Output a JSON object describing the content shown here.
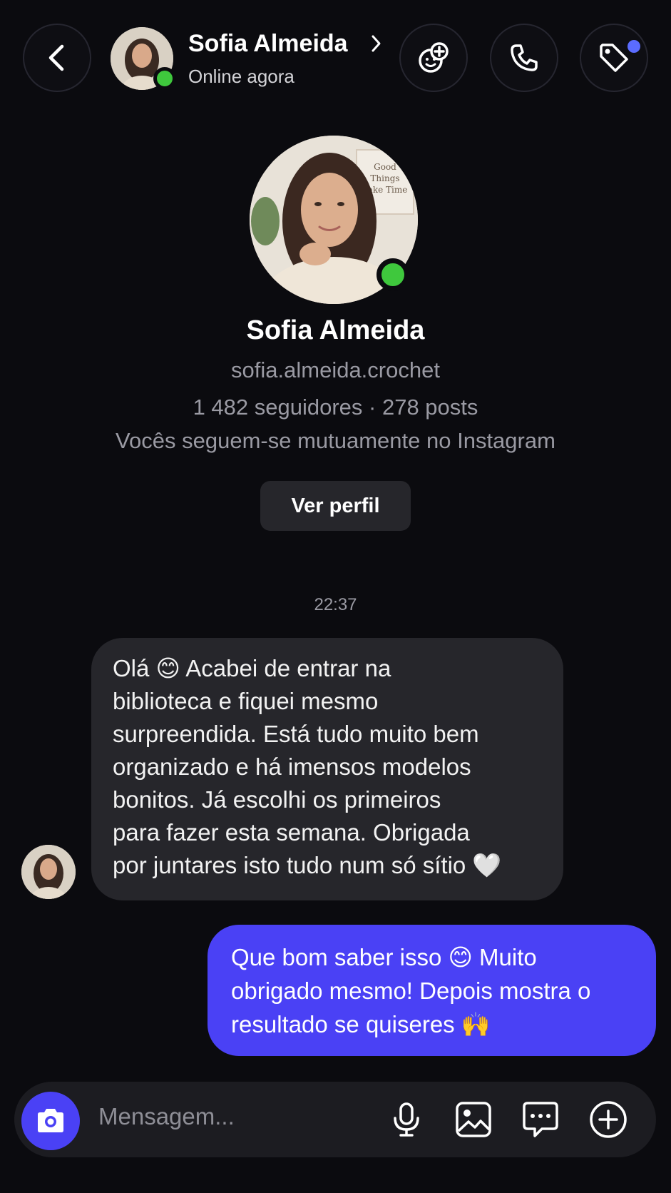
{
  "header": {
    "name": "Sofia Almeida",
    "status": "Online agora",
    "icons": [
      "back-chevron-icon",
      "sticker-add-icon",
      "phone-icon",
      "tag-icon"
    ]
  },
  "profile": {
    "name": "Sofia Almeida",
    "username": "sofia.almeida.crochet",
    "stats": "1 482 seguidores · 278 posts",
    "mutual": "Vocês seguem-se mutuamente no Instagram",
    "view_profile_label": "Ver perfil",
    "photo_sign": [
      "Good",
      "Things",
      "Take Time"
    ]
  },
  "conversation": {
    "timestamp": "22:37",
    "incoming": {
      "lines": [
        "Olá 😊 Acabei de entrar na",
        "biblioteca e fiquei mesmo",
        "surpreendida. Está tudo muito bem",
        "organizado e há imensos modelos",
        "bonitos. Já escolhi os primeiros",
        "para fazer esta semana. Obrigada",
        "por juntares isto tudo num só sítio 🤍"
      ]
    },
    "outgoing": {
      "lines": [
        "Que bom saber isso 😊 Muito",
        "obrigado mesmo! Depois mostra o",
        "resultado se quiseres 🙌"
      ]
    }
  },
  "composer": {
    "placeholder": "Mensagem...",
    "icons": [
      "camera-icon",
      "microphone-icon",
      "image-icon",
      "chat-bubble-icon",
      "plus-circle-icon"
    ]
  },
  "colors": {
    "background": "#0b0b0f",
    "accent": "#4a41f5",
    "online": "#3fc83d",
    "incoming_bubble": "#26262b",
    "notification_dot": "#5b6cff"
  }
}
